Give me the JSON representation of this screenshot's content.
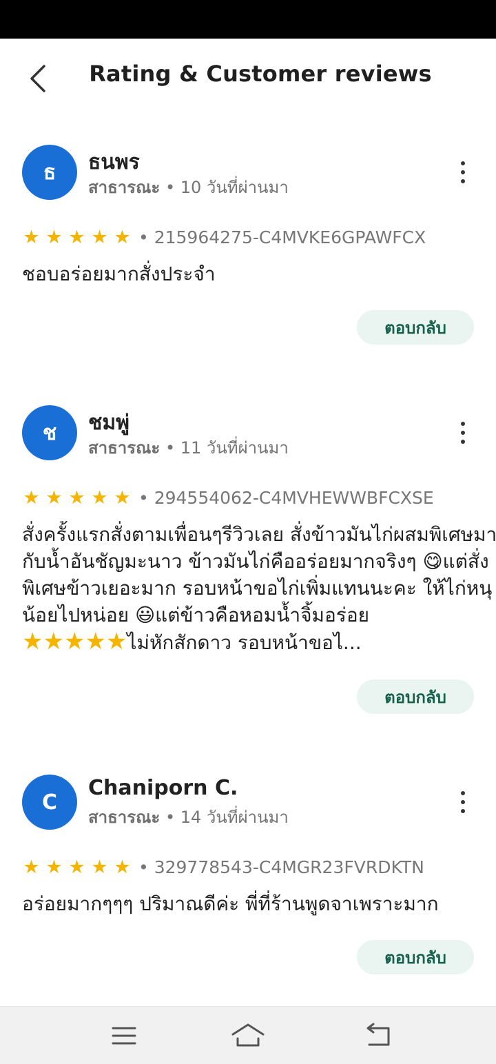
{
  "header": {
    "title": "Rating & Customer reviews"
  },
  "reviews": [
    {
      "avatar_letter": "ธ",
      "name": "ธนพร",
      "visibility": "สาธารณะ",
      "time": "• 10 วันที่ผ่านมา",
      "stars": 5,
      "order_id": "• 215964275-C4MVKE6GPAWFCX",
      "text": "ชอบอร่อยมากสั่งประจำ",
      "reply_label": "ตอบกลับ"
    },
    {
      "avatar_letter": "ช",
      "name": "ชมพู่",
      "visibility": "สาธารณะ",
      "time": "• 11 วันที่ผ่านมา",
      "stars": 5,
      "order_id": "• 294554062-C4MVHEWWBFCXSE",
      "text_parts": [
        "สั่งครั้งแรกสั่งตามเพื่อนๆรีวิวเลย สั่งข้าวมันไก่ผสมพิเศษมา กับน้ำอันชัญมะนาว ข้าวมันไก่คืออร่อยมากจริงๆ ",
        "😋",
        "แต่สั่งพิเศษข้าวเยอะมาก รอบหน้าขอไก่เพิ่มแทนนะคะ ให้ไก่หนุน้อยไปหน่อย ",
        "😃",
        "แต่ข้าวคือหอมน้ำจิ้มอร่อย  ",
        "★★★★★",
        "ไม่หักสักดาว รอบหน้าขอไ..."
      ],
      "reply_label": "ตอบกลับ"
    },
    {
      "avatar_letter": "C",
      "name": "Chaniporn C.",
      "visibility": "สาธารณะ",
      "time": "• 14 วันที่ผ่านมา",
      "stars": 5,
      "order_id": "• 329778543-C4MGR23FVRDKTN",
      "text": "อร่อยมากๆๆๆ ปริมาณดีค่ะ พี่ที่ร้านพูดจาเพราะมาก",
      "reply_label": "ตอบกลับ"
    }
  ],
  "colors": {
    "avatar": "#1a6fd6",
    "star": "#f4b400",
    "reply_bg": "#eaf5f1",
    "reply_text": "#17604a"
  },
  "icons": {
    "back": "chevron-left-icon",
    "more": "more-vertical-icon",
    "nav_menu": "menu-icon",
    "nav_home": "home-icon",
    "nav_back": "back-arrow-icon"
  }
}
